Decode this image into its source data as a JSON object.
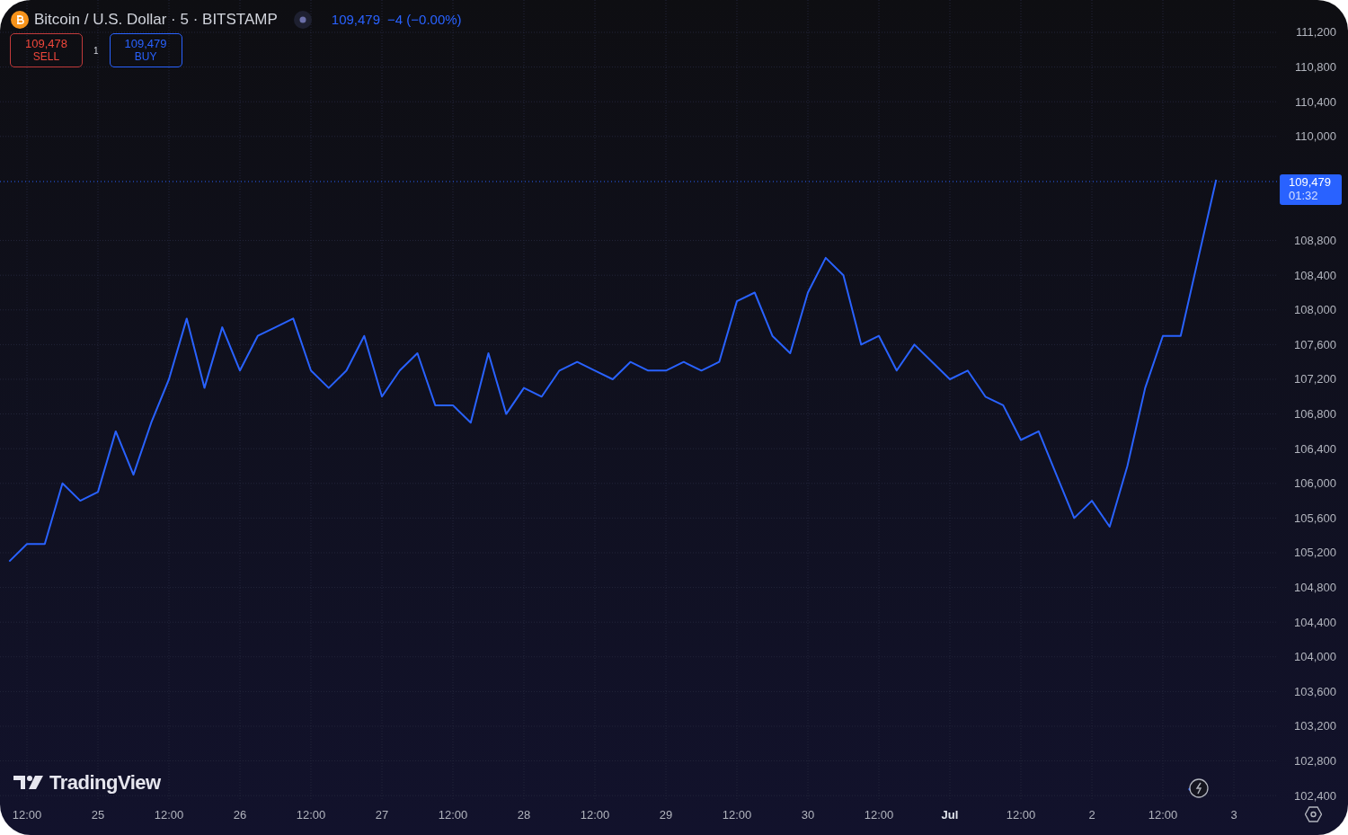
{
  "header": {
    "symbol": "Bitcoin / U.S. Dollar · 5 · BITSTAMP",
    "last_price": "109,479",
    "change": "−4 (−0.00%)"
  },
  "trade": {
    "sell": {
      "price": "109,478",
      "label": "SELL"
    },
    "spread": "1",
    "buy": {
      "price": "109,479",
      "label": "BUY"
    }
  },
  "price_label": {
    "price": "109,479",
    "countdown": "01:32"
  },
  "logo": {
    "text": "TradingView"
  },
  "chart_data": {
    "type": "line",
    "categories": [
      null,
      "12:00",
      null,
      null,
      null,
      "25",
      null,
      null,
      null,
      "12:00",
      null,
      null,
      null,
      "26",
      null,
      null,
      null,
      "12:00",
      null,
      null,
      null,
      "27",
      null,
      null,
      null,
      "12:00",
      null,
      null,
      null,
      "28",
      null,
      null,
      null,
      "12:00",
      null,
      null,
      null,
      "29",
      null,
      null,
      null,
      "12:00",
      null,
      null,
      null,
      "30",
      null,
      null,
      null,
      "12:00",
      null,
      null,
      null,
      "Jul",
      null,
      null,
      null,
      "12:00",
      null,
      null,
      null,
      "2",
      null,
      null,
      null,
      "12:00",
      null,
      null,
      null,
      "3",
      null,
      null
    ],
    "series": [
      {
        "color": "#2962ff",
        "values": [
          105100,
          105300,
          105300,
          106000,
          105800,
          105900,
          106600,
          106100,
          106700,
          107200,
          107900,
          107100,
          107800,
          107300,
          107700,
          107800,
          107900,
          107300,
          107100,
          107300,
          107700,
          107000,
          107300,
          107500,
          106900,
          106900,
          106700,
          107500,
          106800,
          107100,
          107000,
          107300,
          107400,
          107300,
          107200,
          107400,
          107300,
          107300,
          107400,
          107300,
          107400,
          108100,
          108200,
          107700,
          107500,
          108200,
          108600,
          108400,
          107600,
          107700,
          107300,
          107600,
          107400,
          107200,
          107300,
          107000,
          106900,
          106500,
          106600,
          106100,
          105600,
          105800,
          105500,
          106200,
          107100,
          107700,
          107700,
          108600,
          109500,
          null,
          null,
          null
        ]
      }
    ],
    "ylim": [
      102350,
      111573
    ],
    "grid": true,
    "ref_lines": [
      {
        "axis": "y",
        "value": 109480,
        "color": "#2962ff"
      }
    ],
    "yticks": [
      {
        "value": 111200,
        "label": "111,200"
      },
      {
        "value": 110800,
        "label": "110,800"
      },
      {
        "value": 110400,
        "label": "110,400"
      },
      {
        "value": 110000,
        "label": "110,000"
      },
      {
        "value": 108800,
        "label": "108,800"
      },
      {
        "value": 108400,
        "label": "108,400"
      },
      {
        "value": 108000,
        "label": "108,000"
      },
      {
        "value": 107600,
        "label": "107,600"
      },
      {
        "value": 107200,
        "label": "107,200"
      },
      {
        "value": 106800,
        "label": "106,800"
      },
      {
        "value": 106400,
        "label": "106,400"
      },
      {
        "value": 106000,
        "label": "106,000"
      },
      {
        "value": 105600,
        "label": "105,600"
      },
      {
        "value": 105200,
        "label": "105,200"
      },
      {
        "value": 104800,
        "label": "104,800"
      },
      {
        "value": 104400,
        "label": "104,400"
      },
      {
        "value": 104000,
        "label": "104,000"
      },
      {
        "value": 103600,
        "label": "103,600"
      },
      {
        "value": 103200,
        "label": "103,200"
      },
      {
        "value": 102800,
        "label": "102,800"
      },
      {
        "value": 102400,
        "label": "102,400"
      }
    ]
  }
}
